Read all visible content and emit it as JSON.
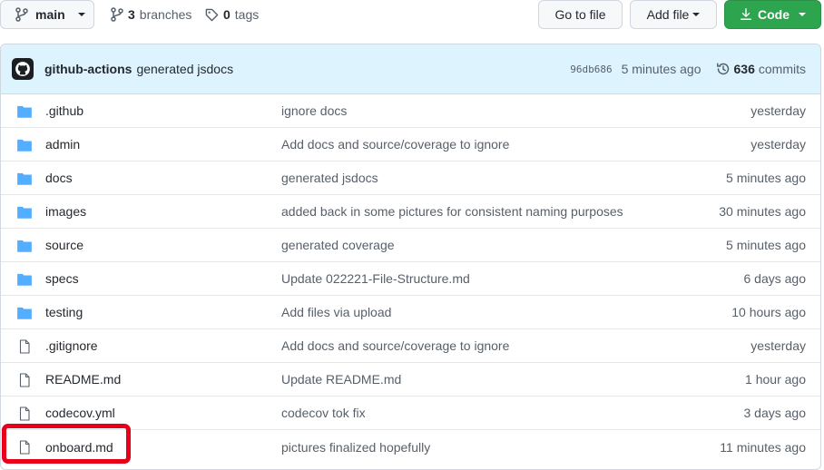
{
  "branch": {
    "name": "main"
  },
  "meta": {
    "branches_count": "3",
    "branches_label": "branches",
    "tags_count": "0",
    "tags_label": "tags"
  },
  "actions": {
    "goto_file": "Go to file",
    "add_file": "Add file",
    "code": "Code"
  },
  "latest_commit": {
    "author": "github-actions",
    "message": "generated jsdocs",
    "sha": "96db686",
    "age": "5 minutes ago",
    "commits_count": "636",
    "commits_label": "commits"
  },
  "files": [
    {
      "type": "folder",
      "name": ".github",
      "message": "ignore docs",
      "age": "yesterday"
    },
    {
      "type": "folder",
      "name": "admin",
      "message": "Add docs and source/coverage to ignore",
      "age": "yesterday"
    },
    {
      "type": "folder",
      "name": "docs",
      "message": "generated jsdocs",
      "age": "5 minutes ago"
    },
    {
      "type": "folder",
      "name": "images",
      "message": "added back in some pictures for consistent naming purposes",
      "age": "30 minutes ago"
    },
    {
      "type": "folder",
      "name": "source",
      "message": "generated coverage",
      "age": "5 minutes ago"
    },
    {
      "type": "folder",
      "name": "specs",
      "message": "Update 022221-File-Structure.md",
      "age": "6 days ago"
    },
    {
      "type": "folder",
      "name": "testing",
      "message": "Add files via upload",
      "age": "10 hours ago"
    },
    {
      "type": "file",
      "name": ".gitignore",
      "message": "Add docs and source/coverage to ignore",
      "age": "yesterday"
    },
    {
      "type": "file",
      "name": "README.md",
      "message": "Update README.md",
      "age": "1 hour ago"
    },
    {
      "type": "file",
      "name": "codecov.yml",
      "message": "codecov tok fix",
      "age": "3 days ago"
    },
    {
      "type": "file",
      "name": "onboard.md",
      "message": "pictures finalized hopefully",
      "age": "11 minutes ago"
    }
  ],
  "colors": {
    "folder_icon": "#54aeff",
    "file_icon": "#57606a",
    "code_button": "#2da44e",
    "highlight": "#e8001a"
  }
}
